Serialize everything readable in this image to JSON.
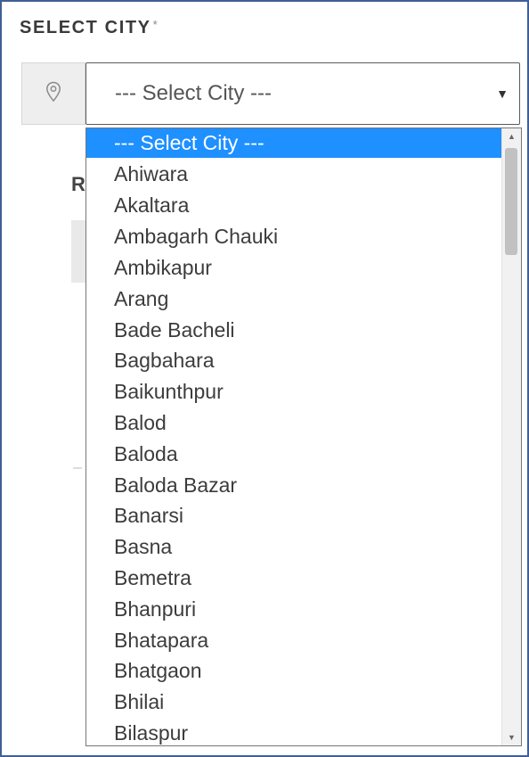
{
  "field": {
    "label": "SELECT CITY",
    "required_mark": "*",
    "selected_value": "--- Select City ---",
    "caret": "▼",
    "icon": "map-pin-icon"
  },
  "background": {
    "partial_letter": "R"
  },
  "dropdown": {
    "selected_index": 0,
    "options": [
      "--- Select City ---",
      "Ahiwara",
      "Akaltara",
      "Ambagarh Chauki",
      "Ambikapur",
      "Arang",
      "Bade Bacheli",
      "Bagbahara",
      "Baikunthpur",
      "Balod",
      "Baloda",
      "Baloda Bazar",
      "Banarsi",
      "Basna",
      "Bemetra",
      "Bhanpuri",
      "Bhatapara",
      "Bhatgaon",
      "Bhilai",
      "Bilaspur"
    ],
    "scroll_up": "▲",
    "scroll_down": "▼"
  },
  "colors": {
    "frame_border": "#3f5f97",
    "highlight": "#1e90ff"
  }
}
